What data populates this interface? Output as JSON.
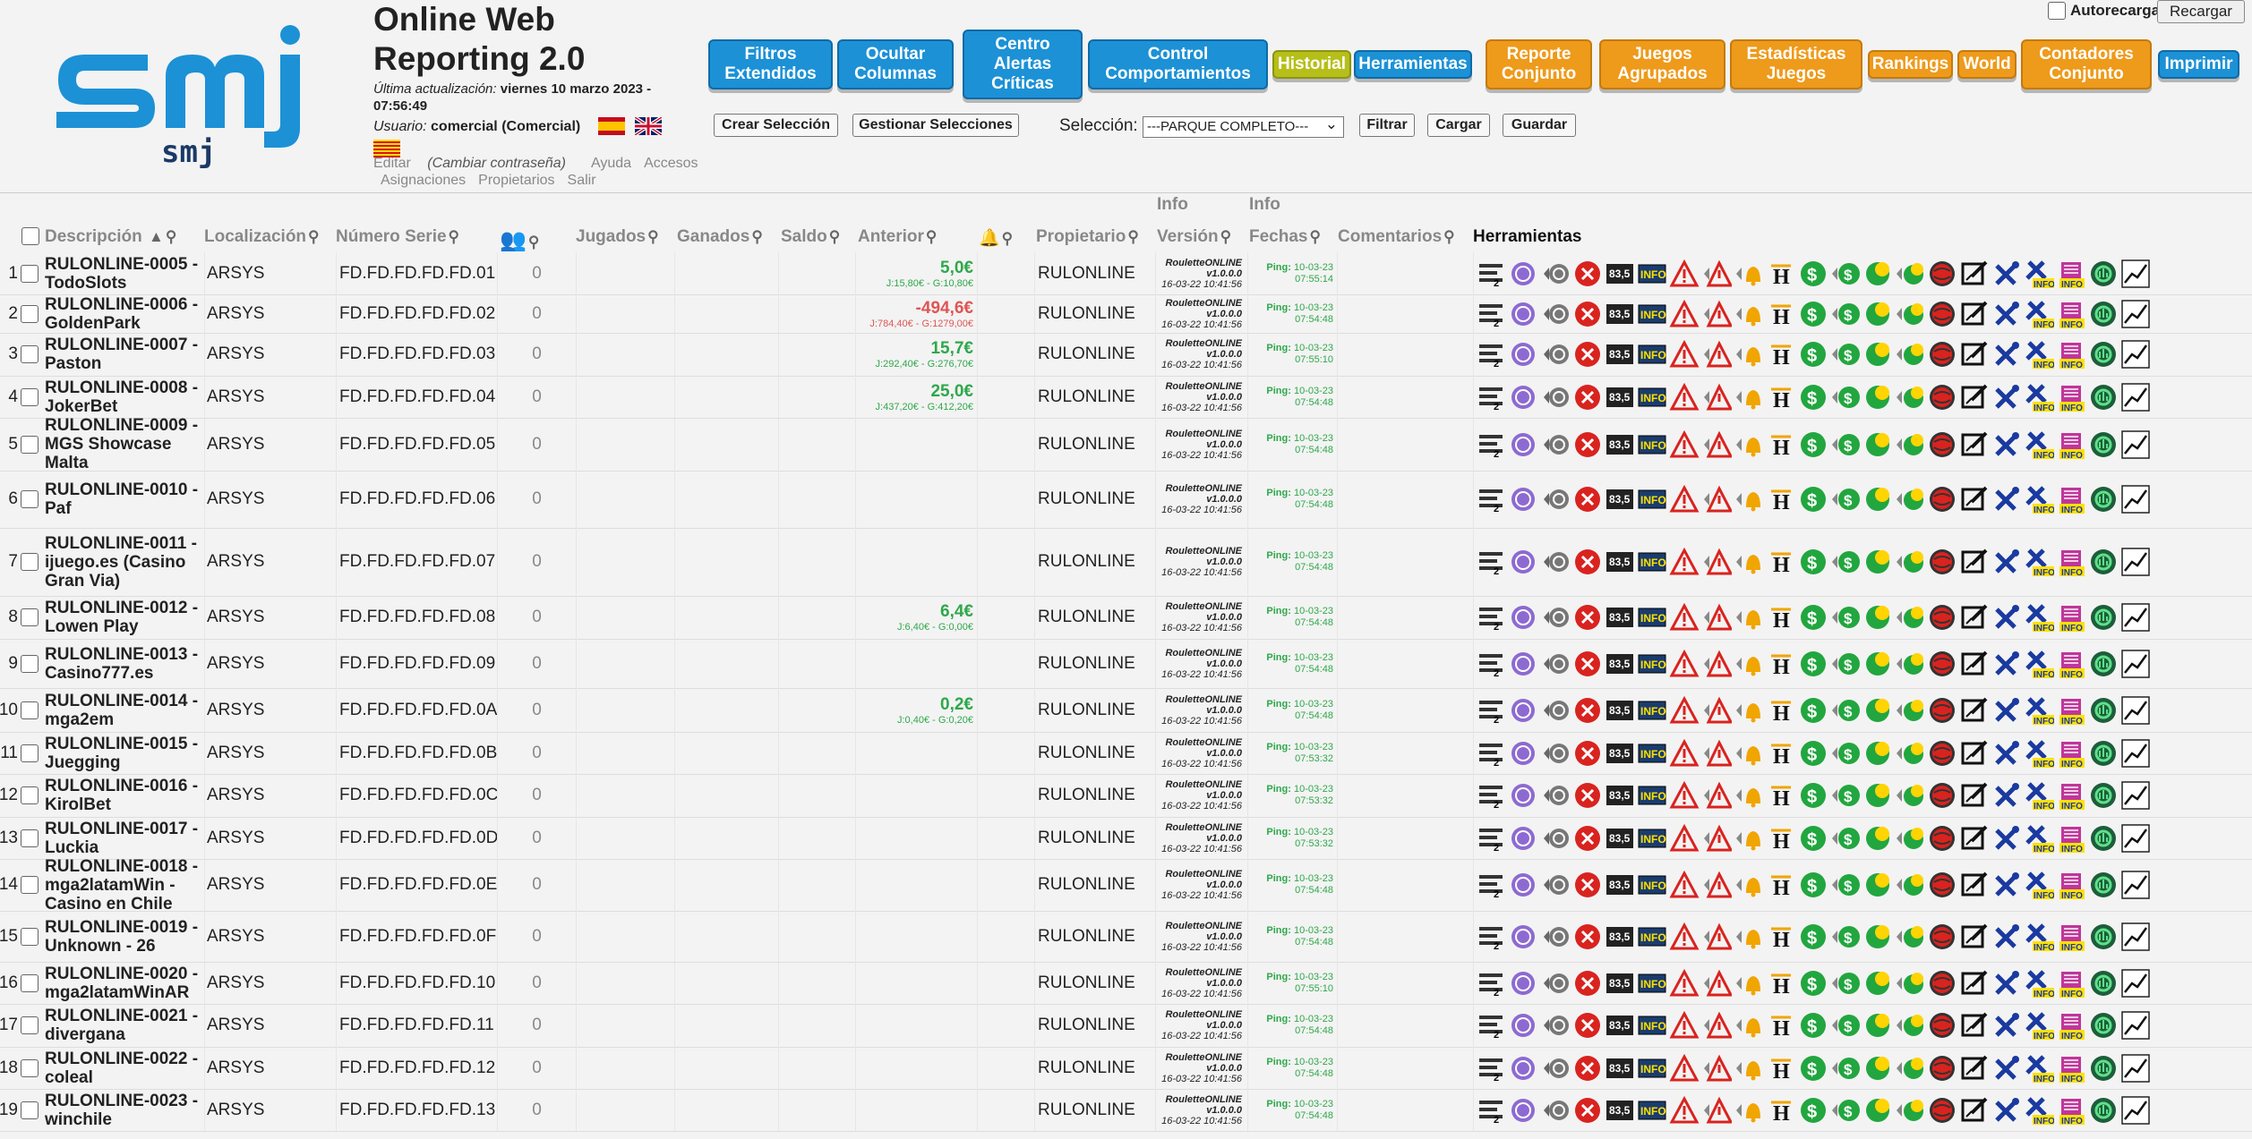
{
  "app": {
    "logo_text": "smj",
    "title": "Online Web Reporting 2.0",
    "last_update_label": "Última actualización:",
    "last_update_value": "viernes 10 marzo 2023 - 07:56:49",
    "user_label": "Usuario:",
    "user_value": "comercial (Comercial)"
  },
  "links": {
    "edit": "Editar",
    "change_password": "(Cambiar contraseña)",
    "help": "Ayuda",
    "access": "Accesos",
    "assignments": "Asignaciones",
    "owners": "Propietarios",
    "logout": "Salir"
  },
  "top_buttons": {
    "filtros": "Filtros Extendidos",
    "ocultar": "Ocultar Columnas",
    "centro": "Centro Alertas Críticas",
    "control": "Control Comportamientos",
    "historial": "Historial",
    "herramientas": "Herramientas",
    "reporte": "Reporte Conjunto",
    "juegos": "Juegos Agrupados",
    "estadisticas": "Estadísticas Juegos",
    "rankings": "Rankings",
    "world": "World",
    "contadores": "Contadores Conjunto",
    "imprimir": "Imprimir"
  },
  "autorecargar": "Autorecargar",
  "recargar": "Recargar",
  "selection": {
    "crear": "Crear Selección",
    "gestionar": "Gestionar Selecciones",
    "label": "Selección:",
    "value": "---PARQUE COMPLETO---",
    "filtrar": "Filtrar",
    "cargar": "Cargar",
    "guardar": "Guardar"
  },
  "columns": {
    "descripcion": "Descripción",
    "localizacion": "Localización",
    "numero_serie": "Número Serie",
    "jugados": "Jugados",
    "ganados": "Ganados",
    "saldo": "Saldo",
    "anterior": "Anterior",
    "propietario": "Propietario",
    "info1": "Info",
    "version": "Versión",
    "info2": "Info",
    "fechas": "Fechas",
    "comentarios": "Comentarios",
    "herramientas": "Herramientas"
  },
  "version_info": {
    "a": "RouletteONLINE",
    "b": "v1.0.0.0",
    "c": "16-03-22 10:41:56"
  },
  "ping_label": "Ping:",
  "colors": {
    "blue": "#1c91d6",
    "orange": "#ee9a1b",
    "olive": "#b6bf1a",
    "positive": "#2ea84a",
    "negative": "#e05555"
  },
  "rows": [
    {
      "n": "1",
      "d": "RULONLINE-0005 - TodoSlots",
      "loc": "ARSYS",
      "s": "FD.FD.FD.FD.FD.01",
      "p": "0",
      "av": "5,0€",
      "ad": "J:15,80€ - G:10,80€",
      "neg": false,
      "prop": "RULONLINE",
      "date": "10-03-23",
      "time": "07:55:14"
    },
    {
      "n": "2",
      "d": "RULONLINE-0006 - GoldenPark",
      "loc": "ARSYS",
      "s": "FD.FD.FD.FD.FD.02",
      "p": "0",
      "av": "-494,6€",
      "ad": "J:784,40€ - G:1279,00€",
      "neg": true,
      "prop": "RULONLINE",
      "date": "10-03-23",
      "time": "07:54:48"
    },
    {
      "n": "3",
      "d": "RULONLINE-0007 - Paston",
      "loc": "ARSYS",
      "s": "FD.FD.FD.FD.FD.03",
      "p": "0",
      "av": "15,7€",
      "ad": "J:292,40€ - G:276,70€",
      "neg": false,
      "prop": "RULONLINE",
      "date": "10-03-23",
      "time": "07:55:10"
    },
    {
      "n": "4",
      "d": "RULONLINE-0008 - JokerBet",
      "loc": "ARSYS",
      "s": "FD.FD.FD.FD.FD.04",
      "p": "0",
      "av": "25,0€",
      "ad": "J:437,20€ - G:412,20€",
      "neg": false,
      "prop": "RULONLINE",
      "date": "10-03-23",
      "time": "07:54:48"
    },
    {
      "n": "5",
      "d": "RULONLINE-0009 - MGS Showcase Malta",
      "loc": "ARSYS",
      "s": "FD.FD.FD.FD.FD.05",
      "p": "0",
      "av": "",
      "ad": "",
      "neg": false,
      "prop": "RULONLINE",
      "date": "10-03-23",
      "time": "07:54:48"
    },
    {
      "n": "6",
      "d": "RULONLINE-0010 - Paf",
      "loc": "ARSYS",
      "s": "FD.FD.FD.FD.FD.06",
      "p": "0",
      "av": "",
      "ad": "",
      "neg": false,
      "prop": "RULONLINE",
      "date": "10-03-23",
      "time": "07:54:48"
    },
    {
      "n": "7",
      "d": "RULONLINE-0011 - ijuego.es (Casino Gran Via)",
      "loc": "ARSYS",
      "s": "FD.FD.FD.FD.FD.07",
      "p": "0",
      "av": "",
      "ad": "",
      "neg": false,
      "prop": "RULONLINE",
      "date": "10-03-23",
      "time": "07:54:48"
    },
    {
      "n": "8",
      "d": "RULONLINE-0012 - Lowen Play",
      "loc": "ARSYS",
      "s": "FD.FD.FD.FD.FD.08",
      "p": "0",
      "av": "6,4€",
      "ad": "J:6,40€ - G:0,00€",
      "neg": false,
      "prop": "RULONLINE",
      "date": "10-03-23",
      "time": "07:54:48"
    },
    {
      "n": "9",
      "d": "RULONLINE-0013 - Casino777.es",
      "loc": "ARSYS",
      "s": "FD.FD.FD.FD.FD.09",
      "p": "0",
      "av": "",
      "ad": "",
      "neg": false,
      "prop": "RULONLINE",
      "date": "10-03-23",
      "time": "07:54:48"
    },
    {
      "n": "10",
      "d": "RULONLINE-0014 - mga2em",
      "loc": "ARSYS",
      "s": "FD.FD.FD.FD.FD.0A",
      "p": "0",
      "av": "0,2€",
      "ad": "J:0,40€ - G:0,20€",
      "neg": false,
      "prop": "RULONLINE",
      "date": "10-03-23",
      "time": "07:54:48"
    },
    {
      "n": "11",
      "d": "RULONLINE-0015 - Juegging",
      "loc": "ARSYS",
      "s": "FD.FD.FD.FD.FD.0B",
      "p": "0",
      "av": "",
      "ad": "",
      "neg": false,
      "prop": "RULONLINE",
      "date": "10-03-23",
      "time": "07:53:32"
    },
    {
      "n": "12",
      "d": "RULONLINE-0016 - KirolBet",
      "loc": "ARSYS",
      "s": "FD.FD.FD.FD.FD.0C",
      "p": "0",
      "av": "",
      "ad": "",
      "neg": false,
      "prop": "RULONLINE",
      "date": "10-03-23",
      "time": "07:53:32"
    },
    {
      "n": "13",
      "d": "RULONLINE-0017 - Luckia",
      "loc": "ARSYS",
      "s": "FD.FD.FD.FD.FD.0D",
      "p": "0",
      "av": "",
      "ad": "",
      "neg": false,
      "prop": "RULONLINE",
      "date": "10-03-23",
      "time": "07:53:32"
    },
    {
      "n": "14",
      "d": "RULONLINE-0018 - mga2latamWin - Casino en Chile",
      "loc": "ARSYS",
      "s": "FD.FD.FD.FD.FD.0E",
      "p": "0",
      "av": "",
      "ad": "",
      "neg": false,
      "prop": "RULONLINE",
      "date": "10-03-23",
      "time": "07:54:48"
    },
    {
      "n": "15",
      "d": "RULONLINE-0019 - Unknown - 26",
      "loc": "ARSYS",
      "s": "FD.FD.FD.FD.FD.0F",
      "p": "0",
      "av": "",
      "ad": "",
      "neg": false,
      "prop": "RULONLINE",
      "date": "10-03-23",
      "time": "07:54:48"
    },
    {
      "n": "16",
      "d": "RULONLINE-0020 - mga2latamWinAR",
      "loc": "ARSYS",
      "s": "FD.FD.FD.FD.FD.10",
      "p": "0",
      "av": "",
      "ad": "",
      "neg": false,
      "prop": "RULONLINE",
      "date": "10-03-23",
      "time": "07:55:10"
    },
    {
      "n": "17",
      "d": "RULONLINE-0021 - divergana",
      "loc": "ARSYS",
      "s": "FD.FD.FD.FD.FD.11",
      "p": "0",
      "av": "",
      "ad": "",
      "neg": false,
      "prop": "RULONLINE",
      "date": "10-03-23",
      "time": "07:54:48"
    },
    {
      "n": "18",
      "d": "RULONLINE-0022 - coleal",
      "loc": "ARSYS",
      "s": "FD.FD.FD.FD.FD.12",
      "p": "0",
      "av": "",
      "ad": "",
      "neg": false,
      "prop": "RULONLINE",
      "date": "10-03-23",
      "time": "07:54:48"
    },
    {
      "n": "19",
      "d": "RULONLINE-0023 - winchile",
      "loc": "ARSYS",
      "s": "FD.FD.FD.FD.FD.13",
      "p": "0",
      "av": "",
      "ad": "",
      "neg": false,
      "prop": "RULONLINE",
      "date": "10-03-23",
      "time": "07:54:48"
    }
  ],
  "tool_icons": [
    "list-icon",
    "coin-purple-icon",
    "rewind-gray-icon",
    "red-x-icon",
    "counter-display-icon",
    "info-box-icon",
    "warning-triangle-icon",
    "rewind-warning-icon",
    "rewind-bell-icon",
    "h-hat-icon",
    "dollar-green-icon",
    "rewind-dollar-icon",
    "coin-yellow-icon",
    "rewind-coin-icon",
    "globe-red-icon",
    "edit-square-icon",
    "tools-icon",
    "tools-info-icon",
    "info-stack-icon",
    "refresh-green-icon",
    "chart-line-icon"
  ]
}
